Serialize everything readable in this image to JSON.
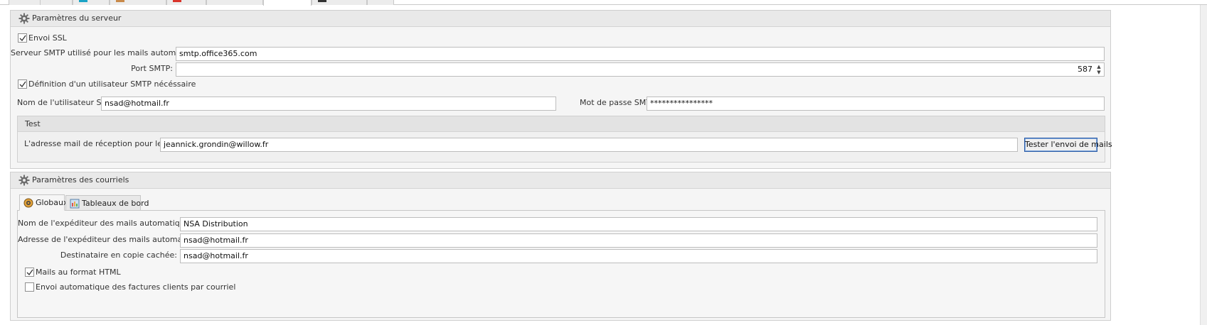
{
  "server_group": {
    "title": "Paramètres du serveur",
    "ssl_label": "Envoi SSL",
    "ssl_checked": true,
    "smtp_server_label": "Serveur SMTP utilisé pour les mails automatiques:",
    "smtp_server_value": "smtp.office365.com",
    "port_label": "Port SMTP:",
    "port_value": "587",
    "auth_label": "Définition d'un utilisateur SMTP nécéssaire",
    "auth_checked": true,
    "user_label": "Nom de l'utilisateur SMTP:",
    "user_value": "nsad@hotmail.fr",
    "password_label": "Mot de passe SMTP:",
    "password_value": "****************",
    "test": {
      "title": "Test",
      "address_label": "L'adresse mail de réception pour les tests:",
      "address_value": "jeannick.grondin@willow.fr",
      "button_label": "Tester l'envoi de mails"
    }
  },
  "mail_group": {
    "title": "Paramètres des courriels",
    "tabs": [
      {
        "label": "Globaux",
        "icon": "globe-icon",
        "active": true
      },
      {
        "label": "Tableaux de bord",
        "icon": "dashboard-icon",
        "active": false
      }
    ],
    "sender_name_label": "Nom de l'expéditeur des mails automatiques:",
    "sender_name_value": "NSA Distribution",
    "sender_address_label": "Adresse de l'expéditeur des mails automatiques:",
    "sender_address_value": "nsad@hotmail.fr",
    "bcc_label": "Destinataire en copie cachée:",
    "bcc_value": "nsad@hotmail.fr",
    "html_label": "Mails au format HTML",
    "html_checked": true,
    "auto_invoice_label": "Envoi automatique des factures clients par courriel",
    "auto_invoice_checked": false
  },
  "colors": {
    "accent": "#2e5ea8",
    "panel": "#f5f5f5",
    "header": "#e9e9e9"
  }
}
